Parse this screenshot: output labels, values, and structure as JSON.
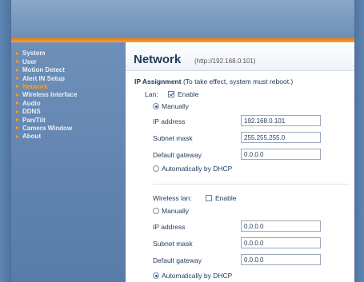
{
  "sidebar": {
    "items": [
      {
        "label": "System"
      },
      {
        "label": "User"
      },
      {
        "label": "Motion Detect"
      },
      {
        "label": "Alert IN Setup"
      },
      {
        "label": "Network"
      },
      {
        "label": "Wireless Interface"
      },
      {
        "label": "Audio"
      },
      {
        "label": "DDNS"
      },
      {
        "label": "Pan/Tilt"
      },
      {
        "label": "Camera Window"
      },
      {
        "label": "About"
      }
    ],
    "active_item": "Network"
  },
  "header": {
    "title": "Network",
    "url": "(http://192.168.0.101)"
  },
  "ip_assignment": {
    "heading": "IP Assignment",
    "note": "(To take effect, system must reboot.)"
  },
  "lan": {
    "label": "Lan:",
    "enable_label": "Enable",
    "enabled": true,
    "manual_label": "Manually",
    "manual_selected": true,
    "ip_label": "IP address",
    "ip_value": "192.168.0.101",
    "subnet_label": "Subnet mask",
    "subnet_value": "255.255.255.0",
    "gateway_label": "Default gateway",
    "gateway_value": "0.0.0.0",
    "dhcp_label": "Automatically by DHCP",
    "dhcp_selected": false
  },
  "wireless": {
    "label": "Wireless lan:",
    "enable_label": "Enable",
    "enabled": false,
    "manual_label": "Manually",
    "manual_selected": false,
    "ip_label": "IP address",
    "ip_value": "0.0.0.0",
    "subnet_label": "Subnet mask",
    "subnet_value": "0.0.0.0",
    "gateway_label": "Default gateway",
    "gateway_value": "0.0.0.0",
    "dhcp_label": "Automatically by DHCP",
    "dhcp_selected": true
  },
  "colors": {
    "accent": "#ff9a22",
    "sidebar": "#6e8fb8",
    "title_text": "#223a5a"
  }
}
